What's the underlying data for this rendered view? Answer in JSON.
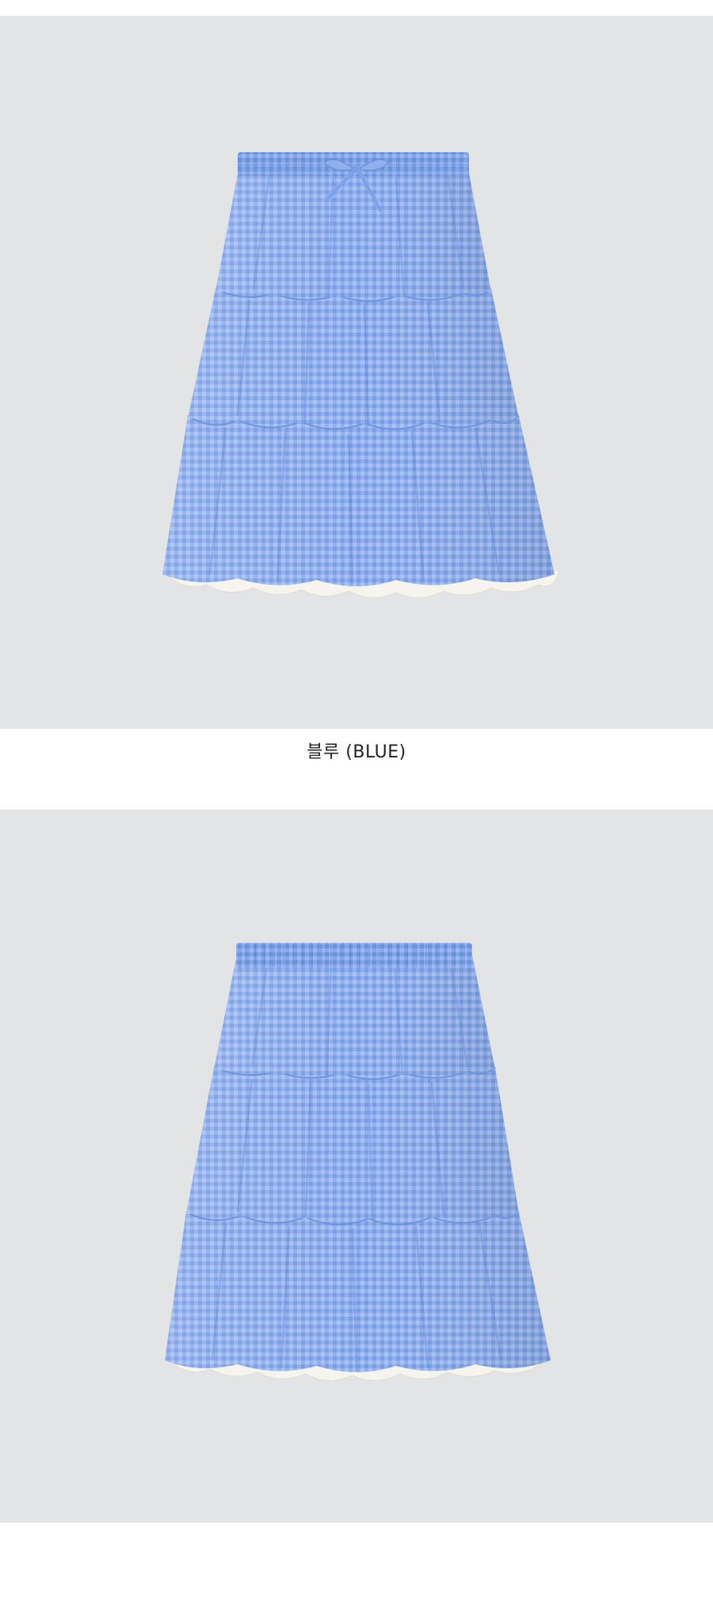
{
  "product": {
    "color_caption": "블루 (BLUE)"
  },
  "colors": {
    "background": "#ffffff",
    "photo_background": "#e3e4e6",
    "fabric_blue": "#8fb0ec",
    "gingham_line": "#5f87d6",
    "ruffle_white": "#f6f4ee"
  },
  "images": {
    "front_view": "gingham-tiered-skirt-front-photo",
    "back_view": "gingham-tiered-skirt-back-photo"
  }
}
